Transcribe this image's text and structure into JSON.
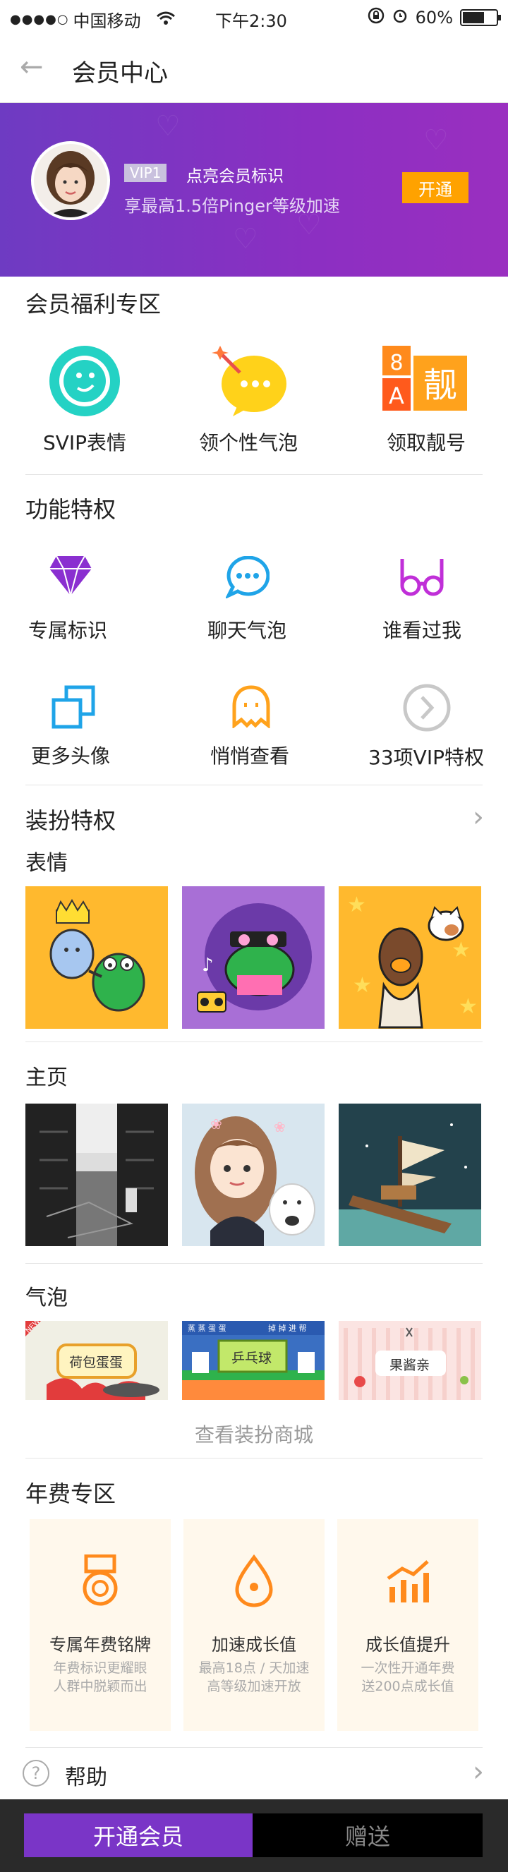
{
  "status_bar": {
    "signal": "●●●●○",
    "carrier": "中国移动",
    "time": "下午2:30",
    "battery": "60%"
  },
  "nav": {
    "title": "会员中心"
  },
  "banner": {
    "vip_tag": "VIP1",
    "vip_text": "点亮会员标识",
    "vip_sub": "享最高1.5倍Pinger等级加速",
    "open_label": "开通"
  },
  "benefits": {
    "title": "会员福利专区",
    "items": [
      {
        "label": "SVIP表情",
        "icon": "smile-icon"
      },
      {
        "label": "领个性气泡",
        "icon": "magic-bubble-icon"
      },
      {
        "label": "领取靓号",
        "icon": "number-badge-icon"
      }
    ],
    "badge_text": {
      "digit": "8",
      "letter": "A",
      "char": "靓"
    }
  },
  "features": {
    "title": "功能特权",
    "items": [
      {
        "label": "专属标识",
        "icon": "diamond-icon"
      },
      {
        "label": "聊天气泡",
        "icon": "chat-bubble-icon"
      },
      {
        "label": "谁看过我",
        "icon": "glasses-icon"
      },
      {
        "label": "更多头像",
        "icon": "avatar-frames-icon"
      },
      {
        "label": "悄悄查看",
        "icon": "ghost-icon"
      },
      {
        "label": "33项VIP特权",
        "icon": "chevron-circle-icon"
      }
    ]
  },
  "dressup": {
    "title": "装扮特权",
    "stickers_title": "表情",
    "homepage_title": "主页",
    "bubbles_title": "气泡",
    "bubble_labels": [
      "荷包蛋蛋",
      "乒乓球",
      "果酱亲"
    ],
    "new_badge": "NEW",
    "bubble_tags": {
      "left": "蒸 蒸 蛋 蛋",
      "right": "掉 掉 进 帮"
    },
    "shop_link": "查看装扮商城"
  },
  "annual": {
    "title": "年费专区",
    "cards": [
      {
        "title": "专属年费铭牌",
        "desc1": "年费标识更耀眼",
        "desc2": "人群中脱颖而出",
        "icon": "medal-icon"
      },
      {
        "title": "加速成长值",
        "desc1": "最高18点 / 天加速",
        "desc2": "高等级加速开放",
        "icon": "speed-icon"
      },
      {
        "title": "成长值提升",
        "desc1": "一次性开通年费",
        "desc2": "送200点成长值",
        "icon": "growth-chart-icon"
      }
    ]
  },
  "help": {
    "label": "帮助",
    "icon_glyph": "?"
  },
  "bottom": {
    "open_member": "开通会员",
    "gift": "赠送"
  },
  "colors": {
    "accent_purple": "#7a35c7",
    "orange": "#ffa200",
    "teal": "#24d2c4"
  }
}
